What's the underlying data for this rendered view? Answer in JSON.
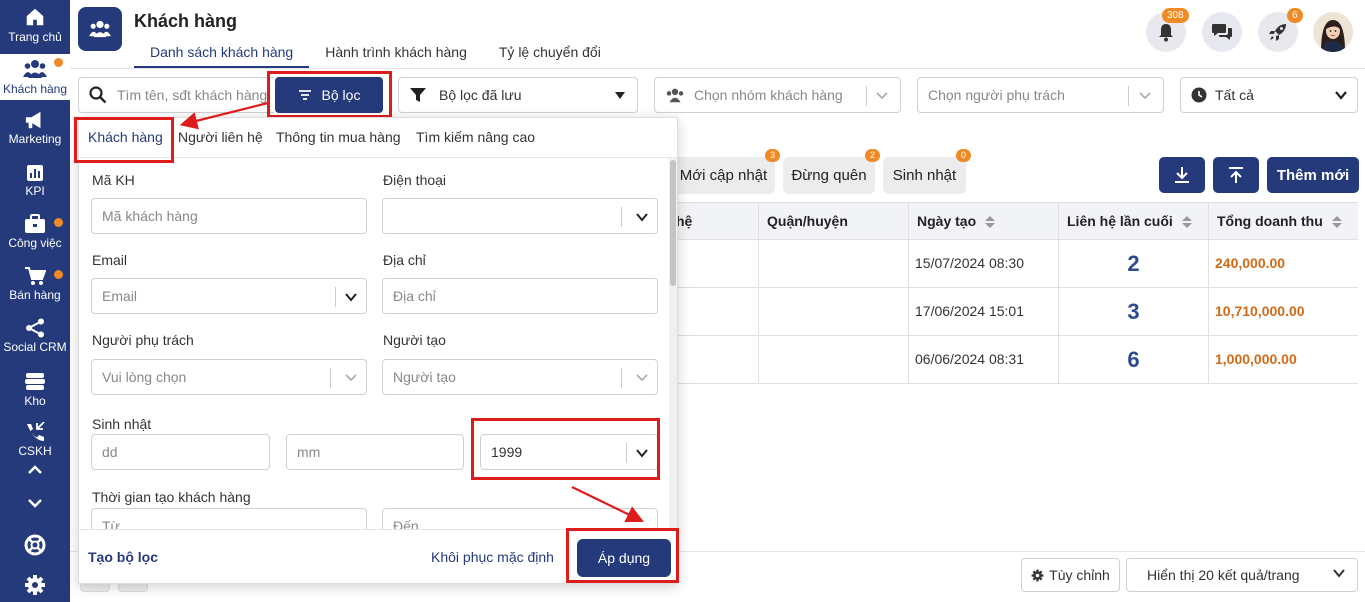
{
  "sidebar": {
    "items": [
      {
        "label": "Trang chủ",
        "icon": "home-icon"
      },
      {
        "label": "Khách hàng",
        "icon": "users-icon",
        "active": true,
        "dot": true
      },
      {
        "label": "Marketing",
        "icon": "megaphone-icon"
      },
      {
        "label": "KPI",
        "icon": "chart-icon"
      },
      {
        "label": "Công việc",
        "icon": "briefcase-icon",
        "dot": true
      },
      {
        "label": "Bán hàng",
        "icon": "cart-icon",
        "dot": true
      },
      {
        "label": "Social CRM",
        "icon": "share-icon"
      },
      {
        "label": "Kho",
        "icon": "warehouse-icon"
      },
      {
        "label": "CSKH",
        "icon": "phone-icon"
      }
    ]
  },
  "header": {
    "title": "Khách hàng",
    "tabs": [
      "Danh sách khách hàng",
      "Hành trình khách hàng",
      "Tỷ lệ chuyển đổi"
    ],
    "active_tab": 0,
    "notifications_badge": "308",
    "rocket_badge": "6"
  },
  "toolbar": {
    "search_placeholder": "Tìm tên, sđt khách hàng",
    "filter_label": "Bộ lọc",
    "saved_filter_label": "Bộ lọc đã lưu",
    "group_placeholder": "Chọn nhóm khách hàng",
    "owner_placeholder": "Chọn người phụ trách",
    "time_value": "Tất cả"
  },
  "chips": [
    {
      "label": "Mới cập nhật",
      "count": "3"
    },
    {
      "label": "Đừng quên",
      "count": "2"
    },
    {
      "label": "Sinh nhật",
      "count": "0"
    }
  ],
  "add_label": "Thêm mới",
  "table": {
    "headers": [
      "hệ",
      "Quận/huyện",
      "Ngày tạo",
      "Liên hệ lần cuối",
      "Tổng doanh thu"
    ],
    "rows": [
      {
        "date": "15/07/2024 08:30",
        "last_contact": "2",
        "revenue": "240,000.00"
      },
      {
        "date": "17/06/2024 15:01",
        "last_contact": "3",
        "revenue": "10,710,000.00"
      },
      {
        "date": "06/06/2024 08:31",
        "last_contact": "6",
        "revenue": "1,000,000.00"
      }
    ]
  },
  "bottom": {
    "customize_label": "Tùy chỉnh",
    "page_size_label": "Hiển thị 20 kết quả/trang"
  },
  "panel": {
    "tabs": [
      "Khách hàng",
      "Người liên hệ",
      "Thông tin mua hàng",
      "Tìm kiếm nâng cao"
    ],
    "active_tab": 0,
    "fields": {
      "code_label": "Mã KH",
      "code_placeholder": "Mã khách hàng",
      "phone_label": "Điện thoại",
      "email_label": "Email",
      "email_placeholder": "Email",
      "address_label": "Địa chỉ",
      "address_placeholder": "Địa chỉ",
      "owner_label": "Người phụ trách",
      "owner_placeholder": "Vui lòng chọn",
      "creator_label": "Người tạo",
      "creator_placeholder": "Người tạo",
      "birthday_label": "Sinh nhật",
      "day_placeholder": "dd",
      "month_placeholder": "mm",
      "year_value": "1999",
      "created_time_label": "Thời gian tạo khách hàng",
      "from_placeholder": "Từ",
      "to_placeholder": "Đến"
    },
    "save_filter_label": "Tạo bộ lọc",
    "reset_label": "Khôi phục mặc định",
    "apply_label": "Áp dụng"
  },
  "colors": {
    "primary": "#243a7a",
    "accent": "#f08a24",
    "highlight": "#dd1c1c",
    "revenue": "#d06a14"
  }
}
